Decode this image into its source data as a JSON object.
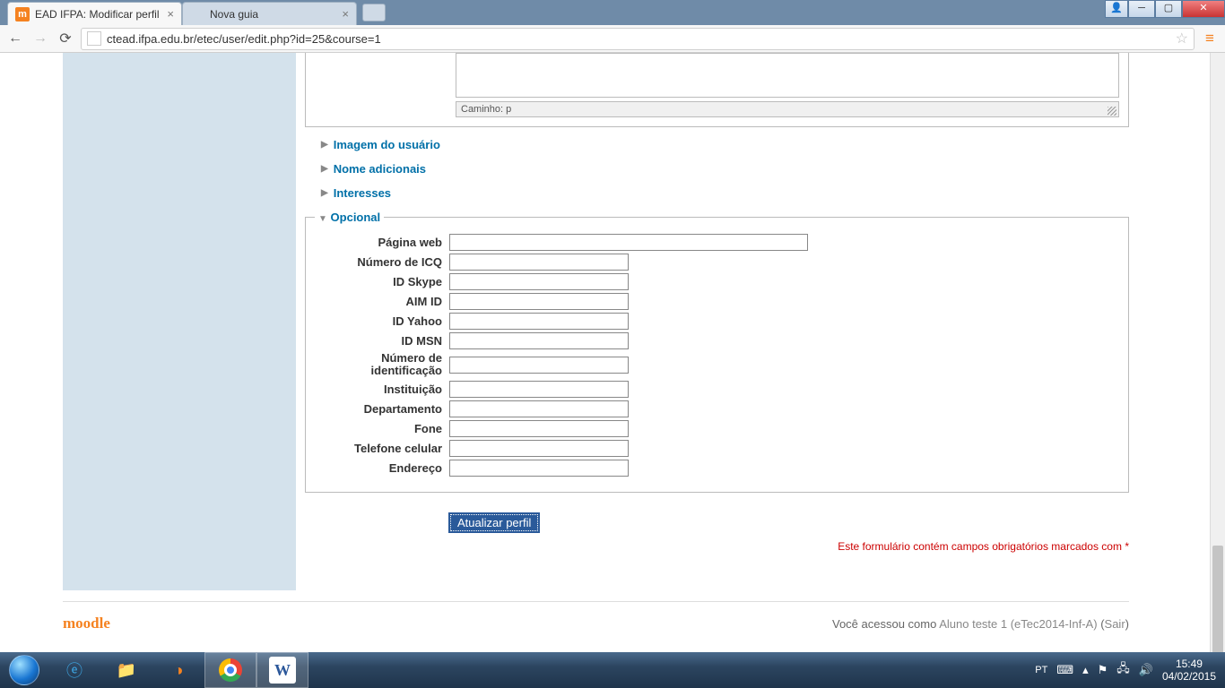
{
  "browser": {
    "tabs": [
      {
        "title": "EAD IFPA: Modificar perfil",
        "active": true
      },
      {
        "title": "Nova guia",
        "active": false
      }
    ],
    "url": "ctead.ifpa.edu.br/etec/user/edit.php?id=25&course=1"
  },
  "editor": {
    "path_label": "Caminho: p"
  },
  "sections": {
    "imagem": "Imagem do usuário",
    "nomes": "Nome adicionais",
    "interesses": "Interesses",
    "opcional": "Opcional"
  },
  "fields": {
    "pagina_web": {
      "label": "Página web",
      "value": ""
    },
    "icq": {
      "label": "Número de ICQ",
      "value": ""
    },
    "skype": {
      "label": "ID Skype",
      "value": ""
    },
    "aim": {
      "label": "AIM ID",
      "value": ""
    },
    "yahoo": {
      "label": "ID Yahoo",
      "value": ""
    },
    "msn": {
      "label": "ID MSN",
      "value": ""
    },
    "idnumber": {
      "label": "Número de identificação",
      "value": ""
    },
    "instituicao": {
      "label": "Instituição",
      "value": ""
    },
    "departamento": {
      "label": "Departamento",
      "value": ""
    },
    "fone": {
      "label": "Fone",
      "value": ""
    },
    "celular": {
      "label": "Telefone celular",
      "value": ""
    },
    "endereco": {
      "label": "Endereço",
      "value": ""
    }
  },
  "submit": {
    "label": "Atualizar perfil"
  },
  "required_note": "Este formulário contém campos obrigatórios marcados com ",
  "required_mark": "*",
  "footer": {
    "logo": "moodle",
    "logged_prefix": "Você acessou como ",
    "user": "Aluno teste 1 (eTec2014-Inf-A)",
    "logout": "Sair"
  },
  "tray": {
    "lang": "PT",
    "time": "15:49",
    "date": "04/02/2015"
  }
}
